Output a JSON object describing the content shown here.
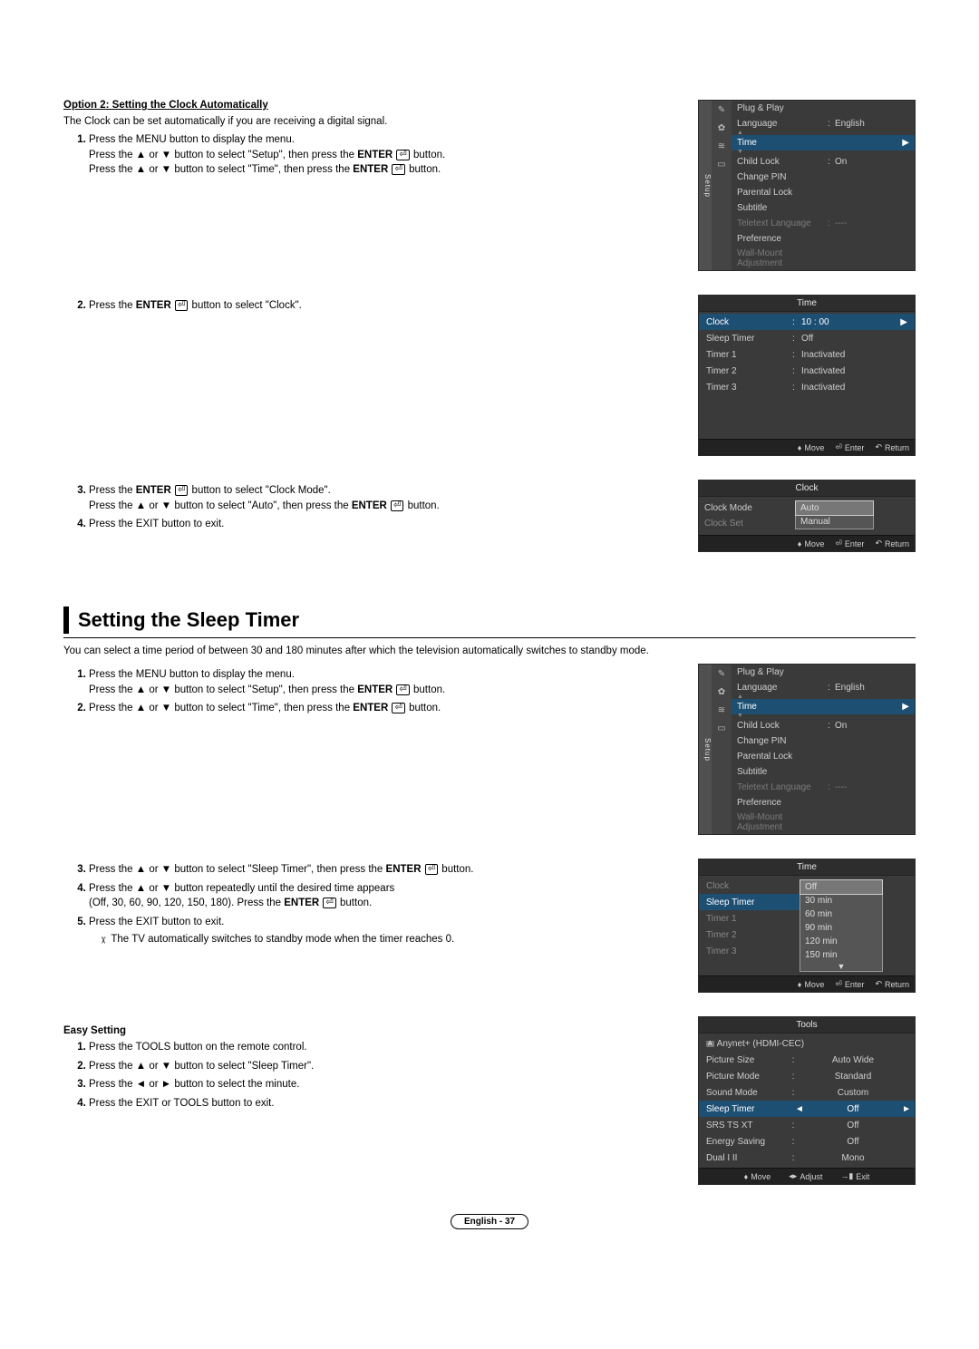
{
  "option2": {
    "title": "Option 2: Setting the Clock Automatically",
    "intro": "The Clock can be set automatically if you are receiving a digital signal.",
    "steps": {
      "s1a": "Press the MENU button to display the menu.",
      "s1b_pre": "Press the ▲ or ▼ button to select \"Setup\", then press the ",
      "s1b_mid": "ENTER",
      "s1b_post": " button.",
      "s1c_pre": "Press the ▲ or ▼ button to select \"Time\", then press the ",
      "s1c_mid": "ENTER",
      "s1c_post": " button.",
      "s2_pre": "Press the ",
      "s2_mid": "ENTER",
      "s2_post": " button to select \"Clock\".",
      "s3a_pre": "Press the ",
      "s3a_mid": "ENTER",
      "s3a_post": " button to select \"Clock Mode\".",
      "s3b_pre": "Press the ▲ or ▼ button to select \"Auto\", then press the ",
      "s3b_mid": "ENTER",
      "s3b_post": " button.",
      "s4": "Press the EXIT button to exit."
    }
  },
  "osd_setup": {
    "tab": "Setup",
    "items": [
      {
        "label": "Plug & Play",
        "value": "",
        "dim": false
      },
      {
        "label": "Language",
        "value": "English",
        "colon": true,
        "dim": false
      },
      {
        "label": "Time",
        "value": "",
        "highlight": true,
        "arrow": true
      },
      {
        "label": "Child Lock",
        "value": "On",
        "colon": true
      },
      {
        "label": "Change PIN",
        "value": ""
      },
      {
        "label": "Parental Lock",
        "value": ""
      },
      {
        "label": "Subtitle",
        "value": ""
      },
      {
        "label": "Teletext Language",
        "value": "----",
        "colon": true,
        "dim": true
      },
      {
        "label": "Preference",
        "value": ""
      },
      {
        "label": "Wall-Mount Adjustment",
        "value": "",
        "dim": true
      }
    ]
  },
  "osd_time": {
    "title": "Time",
    "items": [
      {
        "label": "Clock",
        "value": "10 : 00",
        "colon": true,
        "highlight": true,
        "arrow": true
      },
      {
        "label": "Sleep Timer",
        "value": "Off",
        "colon": true
      },
      {
        "label": "Timer 1",
        "value": "Inactivated",
        "colon": true
      },
      {
        "label": "Timer 2",
        "value": "Inactivated",
        "colon": true
      },
      {
        "label": "Timer 3",
        "value": "Inactivated",
        "colon": true
      }
    ],
    "nav": {
      "move": "Move",
      "enter": "Enter",
      "return": "Return"
    }
  },
  "osd_clock": {
    "title": "Clock",
    "clock_mode": "Clock Mode",
    "clock_set": "Clock Set",
    "options": [
      "Auto",
      "Manual"
    ],
    "nav": {
      "move": "Move",
      "enter": "Enter",
      "return": "Return"
    }
  },
  "sleep": {
    "heading": "Setting the Sleep Timer",
    "intro": "You can select a time period of between 30 and 180 minutes after which the television automatically switches to standby mode.",
    "steps": {
      "s1a": "Press the MENU button to display the menu.",
      "s1b_pre": "Press the ▲ or ▼ button to select \"Setup\", then press the ",
      "s1b_mid": "ENTER",
      "s1b_post": " button.",
      "s2_pre": "Press the ▲ or ▼ button to select \"Time\", then press the ",
      "s2_mid": "ENTER",
      "s2_post": " button.",
      "s3_pre": "Press the ▲ or ▼ button to select \"Sleep Timer\", then press the ",
      "s3_mid": "ENTER",
      "s3_post": " button.",
      "s4a": "Press the ▲ or ▼ button repeatedly until the desired time appears",
      "s4b_pre": "(Off, 30, 60, 90, 120, 150, 180). Press the ",
      "s4b_mid": "ENTER",
      "s4b_post": " button.",
      "s5": "Press the EXIT button to exit.",
      "note": "The TV automatically switches to standby mode when the timer reaches 0."
    }
  },
  "osd_time2": {
    "title": "Time",
    "items": [
      {
        "label": "Clock",
        "dim": true
      },
      {
        "label": "Sleep Timer",
        "highlight": true
      },
      {
        "label": "Timer 1",
        "dim": true
      },
      {
        "label": "Timer 2",
        "dim": true
      },
      {
        "label": "Timer 3",
        "dim": true
      }
    ],
    "options": [
      "Off",
      "30 min",
      "60 min",
      "90 min",
      "120 min",
      "150 min"
    ],
    "nav": {
      "move": "Move",
      "enter": "Enter",
      "return": "Return"
    }
  },
  "easy": {
    "title": "Easy Setting",
    "s1": "Press the TOOLS button on the remote control.",
    "s2": "Press the ▲ or ▼ button to select \"Sleep Timer\".",
    "s3": "Press the ◄ or ► button to select the minute.",
    "s4": "Press the EXIT or TOOLS button to exit."
  },
  "osd_tools": {
    "title": "Tools",
    "items": [
      {
        "label": "Anynet+ (HDMI-CEC)",
        "badge": true
      },
      {
        "label": "Picture Size",
        "value": "Auto Wide"
      },
      {
        "label": "Picture Mode",
        "value": "Standard"
      },
      {
        "label": "Sound Mode",
        "value": "Custom"
      },
      {
        "label": "Sleep Timer",
        "value": "Off",
        "highlight": true,
        "arrows": true
      },
      {
        "label": "SRS TS XT",
        "value": "Off"
      },
      {
        "label": "Energy Saving",
        "value": "Off"
      },
      {
        "label": "Dual I II",
        "value": "Mono"
      }
    ],
    "nav": {
      "move": "Move",
      "adjust": "Adjust",
      "exit": "Exit"
    }
  },
  "footer": "English - 37"
}
